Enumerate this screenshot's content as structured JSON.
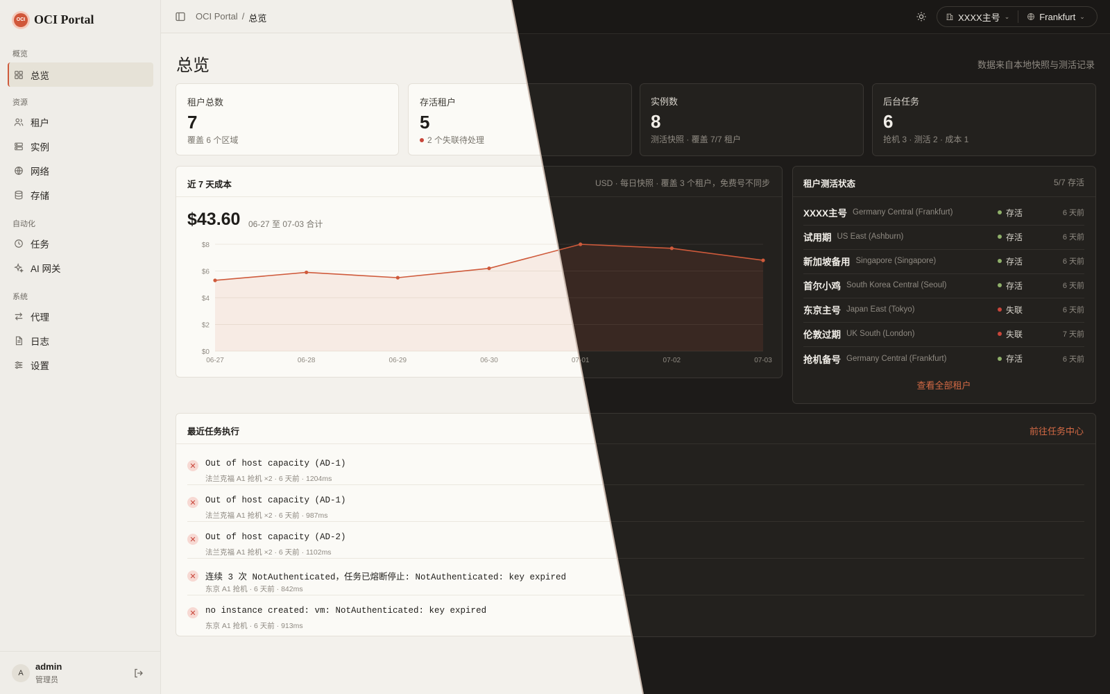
{
  "brand": {
    "name": "OCI Portal",
    "logo_text": "OCI"
  },
  "sidebar": {
    "groups": [
      {
        "label": "概览",
        "items": [
          {
            "label": "总览",
            "icon": "grid-icon",
            "active": true
          }
        ]
      },
      {
        "label": "资源",
        "items": [
          {
            "label": "租户",
            "icon": "users-icon"
          },
          {
            "label": "实例",
            "icon": "server-icon"
          },
          {
            "label": "网络",
            "icon": "globe-icon"
          },
          {
            "label": "存储",
            "icon": "database-icon"
          }
        ]
      },
      {
        "label": "自动化",
        "items": [
          {
            "label": "任务",
            "icon": "clock-icon"
          },
          {
            "label": "AI 网关",
            "icon": "sparkle-icon"
          }
        ]
      },
      {
        "label": "系统",
        "items": [
          {
            "label": "代理",
            "icon": "swap-icon"
          },
          {
            "label": "日志",
            "icon": "file-icon"
          },
          {
            "label": "设置",
            "icon": "sliders-icon"
          }
        ]
      }
    ],
    "user": {
      "avatar": "A",
      "name": "admin",
      "role": "管理员"
    }
  },
  "topbar": {
    "breadcrumb_root": "OCI Portal",
    "breadcrumb_sep": "/",
    "breadcrumb_current": "总览",
    "tenant": "XXXX主号",
    "region": "Frankfurt"
  },
  "page": {
    "title": "总览",
    "note": "数据来自本地快照与测活记录"
  },
  "stats": [
    {
      "label": "租户总数",
      "value": "7",
      "sub": "覆盖 6 个区域"
    },
    {
      "label": "存活租户",
      "value": "5",
      "sub": "2 个失联待处理",
      "dot": "#c8463a"
    },
    {
      "label": "实例数",
      "value": "8",
      "sub": "测活快照 · 覆盖 7/7 租户"
    },
    {
      "label": "后台任务",
      "value": "6",
      "sub": "抢机 3 · 测活 2 · 成本 1"
    }
  ],
  "cost": {
    "title": "近 7 天成本",
    "meta": "USD · 每日快照 · 覆盖 3 个租户，免费号不同步",
    "amount": "$43.60",
    "range": "06-27 至 07-03 合计"
  },
  "chart_data": {
    "type": "area",
    "x": [
      "06-27",
      "06-28",
      "06-29",
      "06-30",
      "07-01",
      "07-02",
      "07-03"
    ],
    "values": [
      5.3,
      5.9,
      5.5,
      6.2,
      8.0,
      7.7,
      6.8
    ],
    "ylim": [
      0,
      8
    ],
    "yticks": [
      "$0",
      "$2",
      "$4",
      "$6",
      "$8"
    ],
    "ytick_values": [
      0,
      2,
      4,
      6,
      8
    ],
    "grid": true,
    "color": "#cf5a3b"
  },
  "tenants_panel": {
    "title": "租户测活状态",
    "meta": "5/7 存活",
    "rows": [
      {
        "name": "XXXX主号",
        "region": "Germany Central (Frankfurt)",
        "status": "存活",
        "ok": true,
        "time": "6 天前"
      },
      {
        "name": "试用期",
        "region": "US East (Ashburn)",
        "status": "存活",
        "ok": true,
        "time": "6 天前"
      },
      {
        "name": "新加坡备用",
        "region": "Singapore (Singapore)",
        "status": "存活",
        "ok": true,
        "time": "6 天前"
      },
      {
        "name": "首尔小鸡",
        "region": "South Korea Central (Seoul)",
        "status": "存活",
        "ok": true,
        "time": "6 天前"
      },
      {
        "name": "东京主号",
        "region": "Japan East (Tokyo)",
        "status": "失联",
        "ok": false,
        "time": "6 天前"
      },
      {
        "name": "伦敦过期",
        "region": "UK South (London)",
        "status": "失联",
        "ok": false,
        "time": "7 天前"
      },
      {
        "name": "抢机备号",
        "region": "Germany Central (Frankfurt)",
        "status": "存活",
        "ok": true,
        "time": "6 天前"
      }
    ],
    "view_all": "查看全部租户"
  },
  "tasks_panel": {
    "title": "最近任务执行",
    "link": "前往任务中心",
    "rows": [
      {
        "title": "Out of host capacity (AD-1)",
        "meta": "法兰克福 A1 抢机 ×2 · 6 天前 · 1204ms"
      },
      {
        "title": "Out of host capacity (AD-1)",
        "meta": "法兰克福 A1 抢机 ×2 · 6 天前 · 987ms"
      },
      {
        "title": "Out of host capacity (AD-2)",
        "meta": "法兰克福 A1 抢机 ×2 · 6 天前 · 1102ms"
      },
      {
        "title": "连续 3 次 NotAuthenticated，任务已熔断停止: NotAuthenticated: key expired",
        "meta": "东京 A1 抢机 · 6 天前 · 842ms"
      },
      {
        "title": "no instance created: vm: NotAuthenticated: key expired",
        "meta": "东京 A1 抢机 · 6 天前 · 913ms"
      }
    ]
  },
  "colors": {
    "accent": "#cf5a3b",
    "ok": "#8fb06a",
    "fail": "#c8463a",
    "dark_bg": "#1d1b19"
  }
}
